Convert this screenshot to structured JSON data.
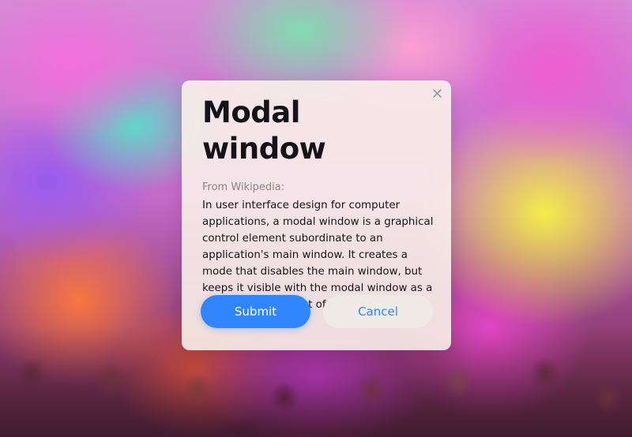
{
  "modal": {
    "title": "Modal window",
    "source": "From Wikipedia:",
    "body": "In user interface design for computer applications, a modal window is a graphical control element subordinate to an application's main window. It creates a mode that disables the main window, but keeps it visible with the modal window as a child window in front of it.",
    "close_icon": "close-icon",
    "submit_label": "Submit",
    "cancel_label": "Cancel"
  },
  "colors": {
    "accent": "#2f86ff",
    "title": "#141418",
    "muted": "#8a8480",
    "modal_bg": "#faf4ec",
    "cancel_bg": "#efeae6"
  }
}
